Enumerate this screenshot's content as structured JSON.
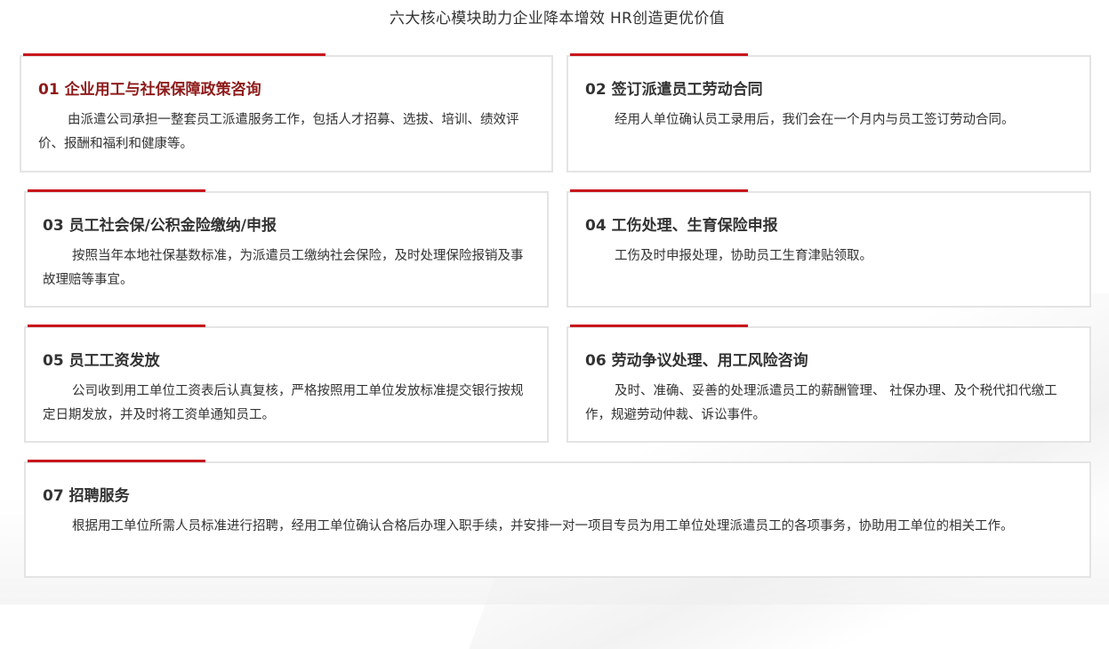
{
  "header": {
    "title": "六大核心模块助力企业降本增效 HR创造更优价值"
  },
  "cards": [
    {
      "title": "01 企业用工与社保保障政策咨询",
      "desc": "由派遣公司承担一整套员工派遣服务工作，包括人才招募、选拔、培训、绩效评价、报酬和福利和健康等。"
    },
    {
      "title": "02 签订派遣员工劳动合同",
      "desc": "经用人单位确认员工录用后，我们会在一个月内与员工签订劳动合同。"
    },
    {
      "title": "03 员工社会保/公积金险缴纳/申报",
      "desc": "按照当年本地社保基数标准，为派遣员工缴纳社会保险，及时处理保险报销及事故理赔等事宜。"
    },
    {
      "title": "04 工伤处理、生育保险申报",
      "desc": "工伤及时申报处理，协助员工生育津贴领取。"
    },
    {
      "title": "05 员工工资发放",
      "desc": "公司收到用工单位工资表后认真复核，严格按照用工单位发放标准提交银行按规定日期发放，并及时将工资单通知员工。"
    },
    {
      "title": "06 劳动争议处理、用工风险咨询",
      "desc": "及时、准确、妥善的处理派遣员工的薪酬管理、 社保办理、及个税代扣代缴工作，规避劳动仲裁、诉讼事件。"
    },
    {
      "title": "07 招聘服务",
      "desc": "根据用工单位所需人员标准进行招聘，经用工单位确认合格后办理入职手续，并安排一对一项目专员为用工单位处理派遣员工的各项事务，协助用工单位的相关工作。"
    }
  ],
  "colors": {
    "accent": "#c8161d",
    "first_title": "#8e1b1b",
    "text": "#333333",
    "border": "#e4e4e4"
  }
}
